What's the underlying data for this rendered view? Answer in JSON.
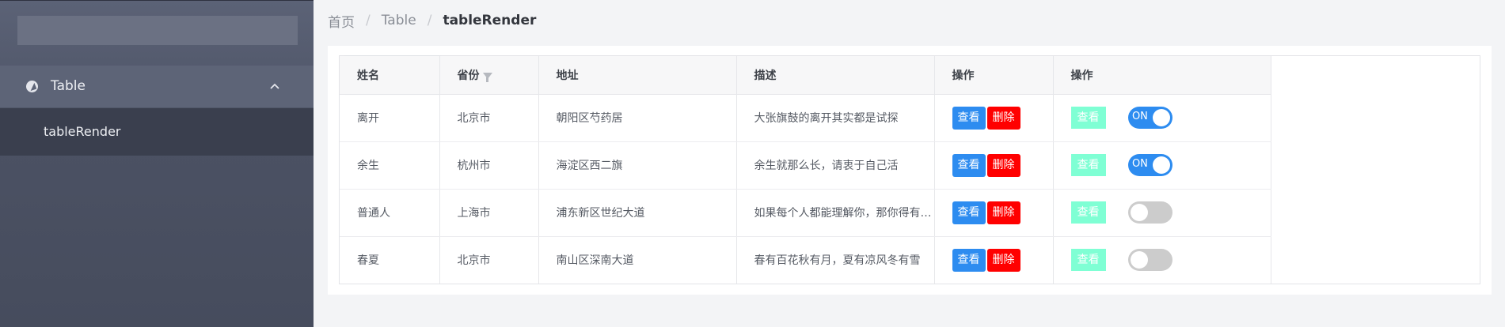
{
  "breadcrumb": {
    "home": "首页",
    "section": "Table",
    "current": "tableRender",
    "separator": "/"
  },
  "sidebar": {
    "group": {
      "label": "Table",
      "icon": "compass-icon",
      "expanded": true
    },
    "items": [
      {
        "label": "tableRender",
        "active": true
      }
    ]
  },
  "table": {
    "columns": [
      "姓名",
      "省份",
      "地址",
      "描述",
      "操作",
      "操作"
    ],
    "rows": [
      {
        "name": "离开",
        "province": "北京市",
        "address": "朝阳区芍药居",
        "desc": "大张旗鼓的离开其实都是试探",
        "view": "查看",
        "delete": "删除",
        "view2": "查看",
        "switch_on": true,
        "switch_label": "ON"
      },
      {
        "name": "余生",
        "province": "杭州市",
        "address": "海淀区西二旗",
        "desc": "余生就那么长，请衷于自己活",
        "view": "查看",
        "delete": "删除",
        "view2": "查看",
        "switch_on": true,
        "switch_label": "ON"
      },
      {
        "name": "普通人",
        "province": "上海市",
        "address": "浦东新区世纪大道",
        "desc": "如果每个人都能理解你，那你得有多普通",
        "view": "查看",
        "delete": "删除",
        "view2": "查看",
        "switch_on": false,
        "switch_label": ""
      },
      {
        "name": "春夏",
        "province": "北京市",
        "address": "南山区深南大道",
        "desc": "春有百花秋有月，夏有凉风冬有雪",
        "view": "查看",
        "delete": "删除",
        "view2": "查看",
        "switch_on": false,
        "switch_label": ""
      }
    ]
  },
  "colors": {
    "primary": "#2d8cf0",
    "danger": "#ff0000",
    "mint": "#7fffd4",
    "sidebar_bg": "#4b5163",
    "sidebar_active": "#3a3f4e"
  }
}
